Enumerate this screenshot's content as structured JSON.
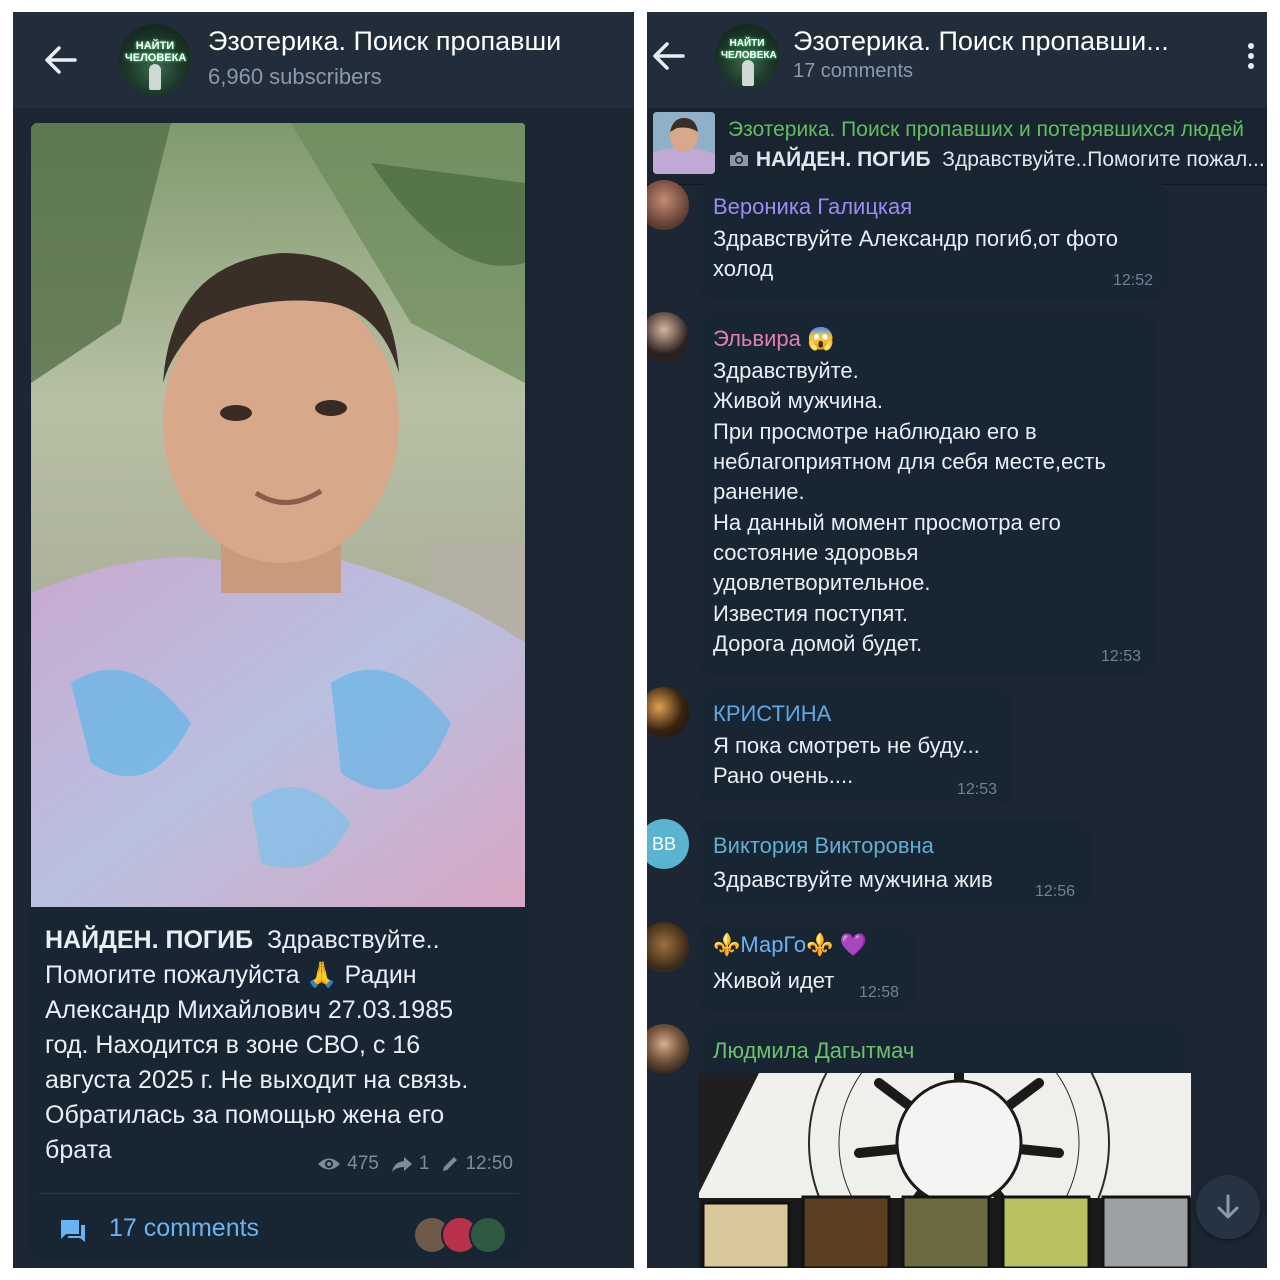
{
  "left": {
    "channel_title": "Эзотерика. Поиск пропавши",
    "subscribers": "6,960 subscribers",
    "avatar_text": "НАЙТИ ЧЕЛОВЕКА",
    "post": {
      "bold": "НАЙДЕН. ПОГИБ",
      "line1": "Здравствуйте..",
      "line2": "Помогите пожалуйста 🙏 Радин",
      "line3": "Александр Михайлович 27.03.1985",
      "line4": "год. Находится в зоне СВО, с 16",
      "line5": "августа 2025 г. Не выходит на связь.",
      "line6": "Обратилась за помощью жена его",
      "line7": "брата",
      "views": "475",
      "shares": "1",
      "time": "12:50"
    },
    "comments_label": "17 comments"
  },
  "right": {
    "channel_title": "Эзотерика. Поиск пропавши...",
    "comments_count": "17 comments",
    "pinned": {
      "title": "Эзотерика. Поиск пропавших и потерявшихся людей",
      "bold": "НАЙДЕН. ПОГИБ",
      "text": "Здравствуйте..Помогите пожал..."
    },
    "messages": [
      {
        "name": "Вероника Галицкая",
        "color": "#9c8cf0",
        "lines": [
          "Здравствуйте Александр погиб,от фото",
          "холод"
        ],
        "time": "12:52"
      },
      {
        "name": "Эльвира 😱",
        "color": "#e37fb1",
        "lines": [
          "Здравствуйте.",
          "Живой мужчина.",
          "При просмотре наблюдаю его в",
          "неблагоприятном для себя месте,есть",
          "ранение.",
          "На данный момент просмотра его",
          "состояние здоровья",
          "удовлетворительное.",
          "Известия поступят.",
          "Дорога домой будет."
        ],
        "time": "12:53"
      },
      {
        "name": "КРИСТИНА",
        "color": "#5fa8e8",
        "lines": [
          "Я пока смотреть не буду...",
          "Рано очень...."
        ],
        "time": "12:53"
      },
      {
        "name": "Виктория Викторовна",
        "color": "#5fb0d0",
        "initials": "ВВ",
        "lines": [
          "Здравствуйте мужчина жив"
        ],
        "time": "12:56"
      },
      {
        "name": "⚜️МарГо⚜️ 💜",
        "color": "#6ab3f3",
        "lines": [
          "Живой идет"
        ],
        "time": "12:58"
      },
      {
        "name": "Людмила Дагытмач",
        "color": "#6cc26c",
        "lines": [],
        "time": ""
      }
    ]
  },
  "colors": {
    "bg": "#1c2733",
    "bubble": "#182533",
    "accent": "#6ab3f3"
  }
}
